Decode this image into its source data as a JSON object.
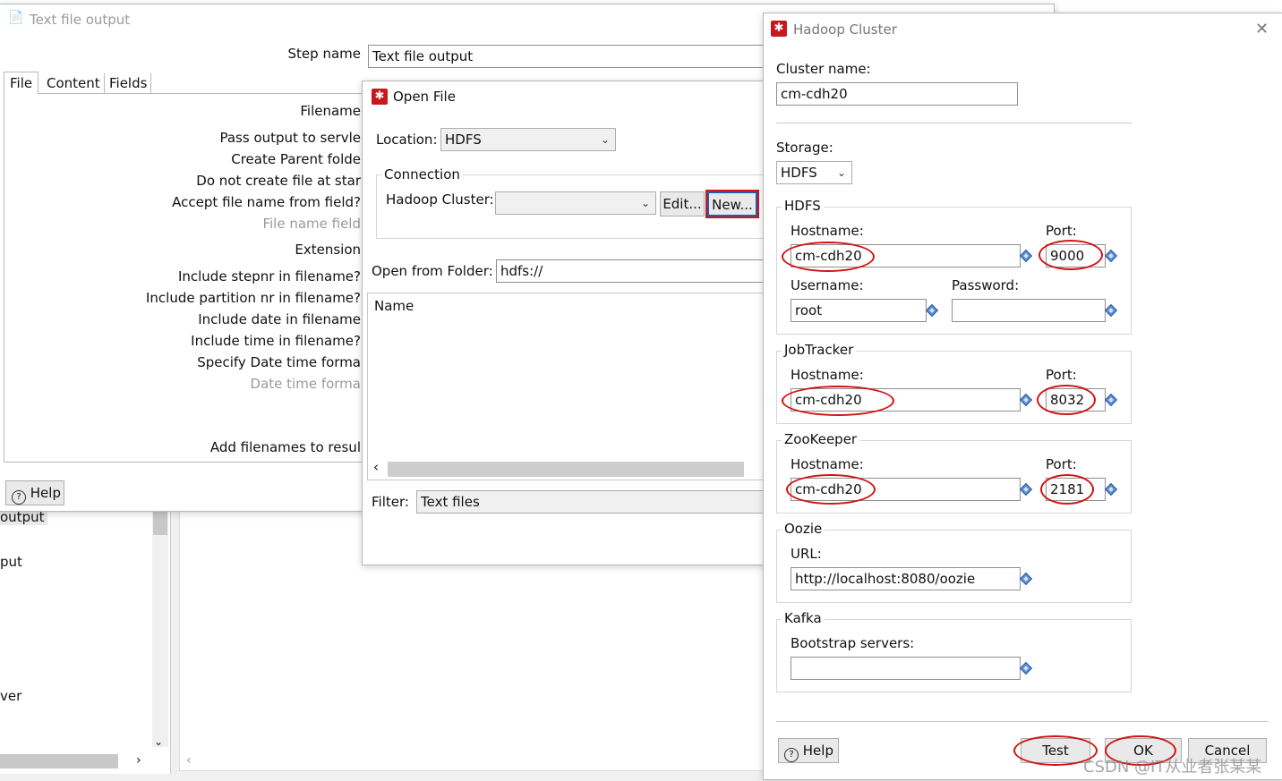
{
  "text_output": {
    "title": "Text file output",
    "step_name_label": "Step name",
    "step_name_value": "Text file output",
    "tabs": [
      "File",
      "Content",
      "Fields"
    ],
    "labels": {
      "filename": "Filename",
      "pass_output": "Pass output to servle",
      "create_parent": "Create Parent folde",
      "do_not_create": "Do not create file at star",
      "accept_file_name": "Accept file name from field?",
      "file_name_field": "File name field",
      "extension": "Extension",
      "include_stepnr": "Include stepnr in filename?",
      "include_partition": "Include partition nr in filename?",
      "include_date": "Include date in filename",
      "include_time": "Include time in filename?",
      "specify_date": "Specify Date time forma",
      "date_time_format": "Date time forma",
      "add_filenames": "Add filenames to resul"
    },
    "help_label": "Help"
  },
  "background": {
    "items": [
      "output",
      "put",
      "ver"
    ]
  },
  "open_file": {
    "title": "Open File",
    "location_label": "Location:",
    "location_value": "HDFS",
    "connection_label": "Connection",
    "cluster_label": "Hadoop Cluster:",
    "edit_label": "Edit...",
    "new_label": "New...",
    "folder_label": "Open from Folder:",
    "folder_value": "hdfs://",
    "name_header": "Name",
    "filter_label": "Filter:",
    "filter_value": "Text files"
  },
  "hadoop": {
    "title": "Hadoop Cluster",
    "cluster_name_label": "Cluster name:",
    "cluster_name_value": "cm-cdh20",
    "storage_label": "Storage:",
    "storage_value": "HDFS",
    "hdfs": {
      "title": "HDFS",
      "hostname_label": "Hostname:",
      "hostname_value": "cm-cdh20",
      "port_label": "Port:",
      "port_value": "9000",
      "username_label": "Username:",
      "username_value": "root",
      "password_label": "Password:",
      "password_value": ""
    },
    "jobtracker": {
      "title": "JobTracker",
      "hostname_label": "Hostname:",
      "hostname_value": "cm-cdh20",
      "port_label": "Port:",
      "port_value": "8032"
    },
    "zookeeper": {
      "title": "ZooKeeper",
      "hostname_label": "Hostname:",
      "hostname_value": "cm-cdh20",
      "port_label": "Port:",
      "port_value": "2181"
    },
    "oozie": {
      "title": "Oozie",
      "url_label": "URL:",
      "url_value": "http://localhost:8080/oozie"
    },
    "kafka": {
      "title": "Kafka",
      "bootstrap_label": "Bootstrap servers:",
      "bootstrap_value": ""
    },
    "help_label": "Help",
    "test_label": "Test",
    "ok_label": "OK",
    "cancel_label": "Cancel"
  },
  "watermark": "CSDN @IT从业者张某某",
  "colors": {
    "annotation": "#d11414",
    "app_icon": "#c8181e",
    "focus": "#1a5fb4"
  }
}
